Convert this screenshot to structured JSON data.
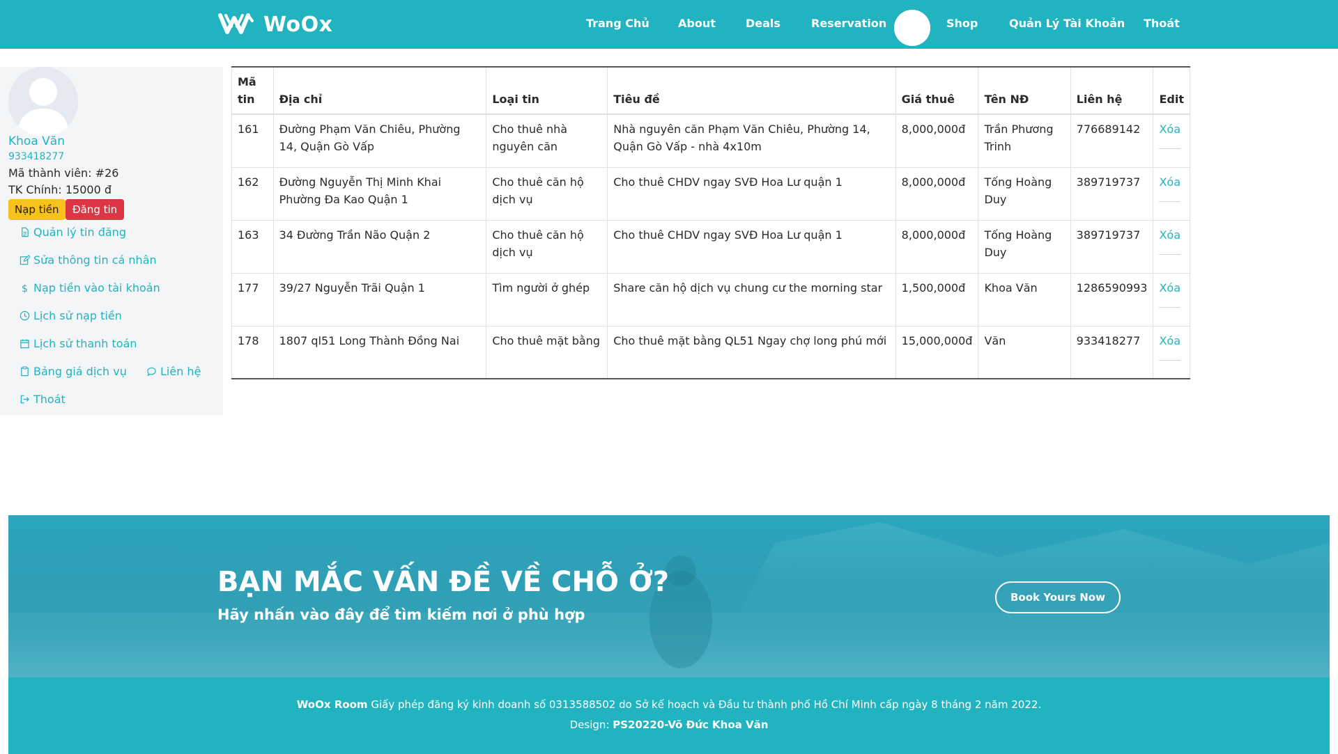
{
  "brand": {
    "name": "WoOx"
  },
  "nav": {
    "home": "Trang Chủ",
    "about": "About",
    "deals": "Deals",
    "reservation": "Reservation",
    "shop": "Shop",
    "account": "Quản Lý Tài Khoản",
    "logout": "Thoát"
  },
  "user": {
    "name": "Khoa Văn",
    "phone": "933418277",
    "member_id": "Mã thành viên: #26",
    "balance": "TK Chính: 15000 đ"
  },
  "sidebar": {
    "deposit_button": "Nạp tiền",
    "post_button": "Đăng tin",
    "links": [
      {
        "label": "Quản lý tin đăng",
        "icon": "document-icon"
      },
      {
        "label": "Sửa thông tin cá nhân",
        "icon": "edit-icon"
      },
      {
        "label": "Nạp tiền vào tài khoản",
        "icon": "dollar-icon"
      },
      {
        "label": "Lịch sử nạp tiền",
        "icon": "clock-icon"
      },
      {
        "label": "Lịch sử thanh toán",
        "icon": "calendar-icon"
      },
      {
        "label": "Bảng giá dịch vụ",
        "icon": "clipboard-icon"
      },
      {
        "label": "Liên hệ",
        "icon": "chat-icon"
      },
      {
        "label": "Thoát",
        "icon": "logout-icon"
      }
    ]
  },
  "table": {
    "headers": [
      "Mã tin",
      "Địa chỉ",
      "Loại tin",
      "Tiêu đề",
      "Giá thuê",
      "Tên NĐ",
      "Liên hệ",
      "Edit"
    ],
    "rows": [
      {
        "id": "161",
        "address": "Đường Phạm Văn Chiêu, Phường 14, Quận Gò Vấp",
        "type": "Cho thuê nhà nguyên căn",
        "title": "Nhà nguyên căn Phạm Văn Chiêu, Phường 14, Quận Gò Vấp - nhà 4x10m",
        "price": "8,000,000đ",
        "owner": "Trần Phương Trinh",
        "contact": "776689142",
        "action": "Xóa"
      },
      {
        "id": "162",
        "address": "Đường Nguyễn Thị Minh Khai Phường Đa Kao Quận 1",
        "type": "Cho thuê căn hộ dịch vụ",
        "title": "Cho thuê CHDV ngay SVĐ Hoa Lư quận 1",
        "price": "8,000,000đ",
        "owner": "Tống Hoàng Duy",
        "contact": "389719737",
        "action": "Xóa"
      },
      {
        "id": "163",
        "address": "34 Đường Trần Não Quận 2",
        "type": "Cho thuê căn hộ dịch vụ",
        "title": "Cho thuê CHDV ngay SVĐ Hoa Lư quận 1",
        "price": "8,000,000đ",
        "owner": "Tống Hoàng Duy",
        "contact": "389719737",
        "action": "Xóa"
      },
      {
        "id": "177",
        "address": "39/27 Nguyễn Trãi Quận 1",
        "type": "Tìm người ở ghép",
        "title": "Share căn hộ dịch vụ chung cư the morning star",
        "price": "1,500,000đ",
        "owner": "Khoa Văn",
        "contact": "1286590993",
        "action": "Xóa"
      },
      {
        "id": "178",
        "address": "1807 ql51 Long Thành Đồng Nai",
        "type": "Cho thuê mặt bằng",
        "title": "Cho thuê mặt bằng QL51 Ngay chợ long phú mới",
        "price": "15,000,000đ",
        "owner": "Văn",
        "contact": "933418277",
        "action": "Xóa"
      }
    ]
  },
  "cta": {
    "title": "BẠN MẮC VẤN ĐỀ VỀ CHỖ Ở?",
    "subtitle": "Hãy nhấn vào đây để tìm kiếm nơi ở phù hợp",
    "button": "Book Yours Now"
  },
  "footer": {
    "brand": "WoOx Room",
    "license": "Giấy phép đăng ký kinh doanh số 0313588502 do Sở kế hoạch và Đầu tư thành phố Hồ Chí Minh cấp ngày 8 tháng 2 năm 2022.",
    "design_label": "Design:",
    "designer": "PS20220-Võ Đức Khoa Văn"
  },
  "colors": {
    "primary": "#22b3c1",
    "warning": "#f8c11c",
    "danger": "#dc3544"
  }
}
